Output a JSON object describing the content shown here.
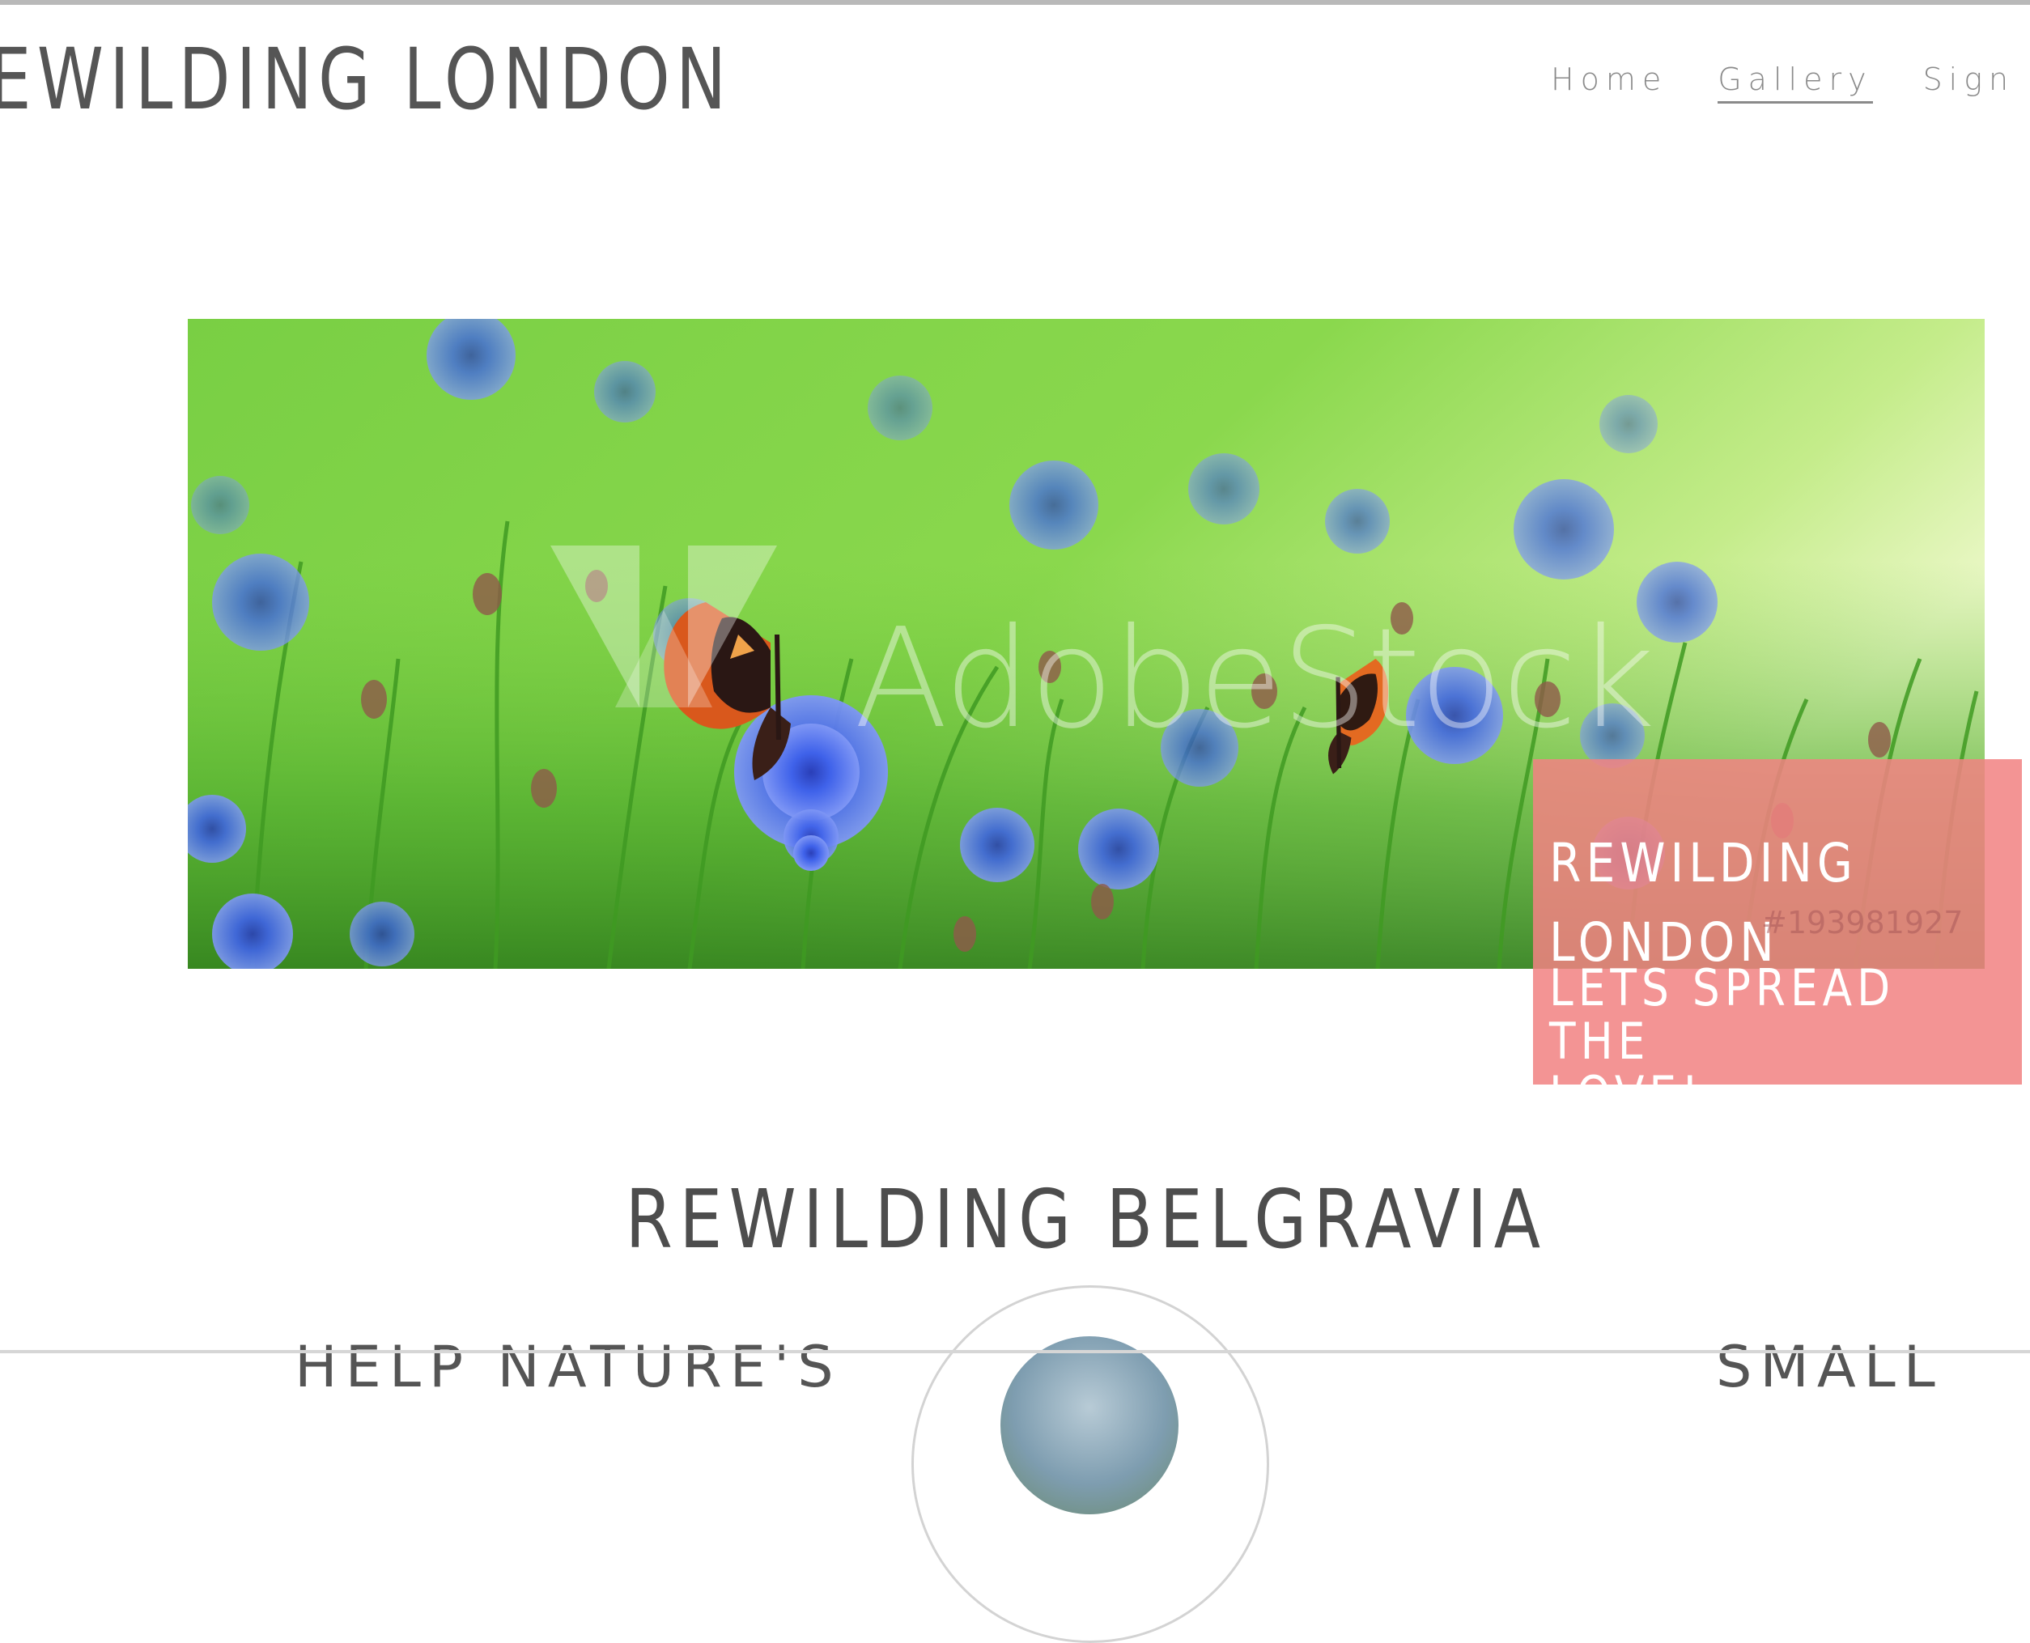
{
  "header": {
    "site_title": "EWILDING LONDON",
    "nav": [
      {
        "label": "Home",
        "active": false
      },
      {
        "label": "Gallery",
        "active": true
      },
      {
        "label": "Sign Up",
        "active": false
      }
    ]
  },
  "hero": {
    "watermark": "AdobeStock",
    "stock_id": "#193981927",
    "callout_title": "REWILDING\nLONDON",
    "callout_subtitle": "LETS SPREAD THE\nLOVE!"
  },
  "section": {
    "title": "REWILDING BELGRAVIA",
    "left_heading_fragment": "HELP NATURE'S",
    "right_heading_fragment": "SMALL"
  },
  "colors": {
    "text": "#555555",
    "nav": "#8a8a8a",
    "callout_bg": "#f18282",
    "meadow": "#6fcf3c",
    "cornflower": "#3d5ee8"
  }
}
